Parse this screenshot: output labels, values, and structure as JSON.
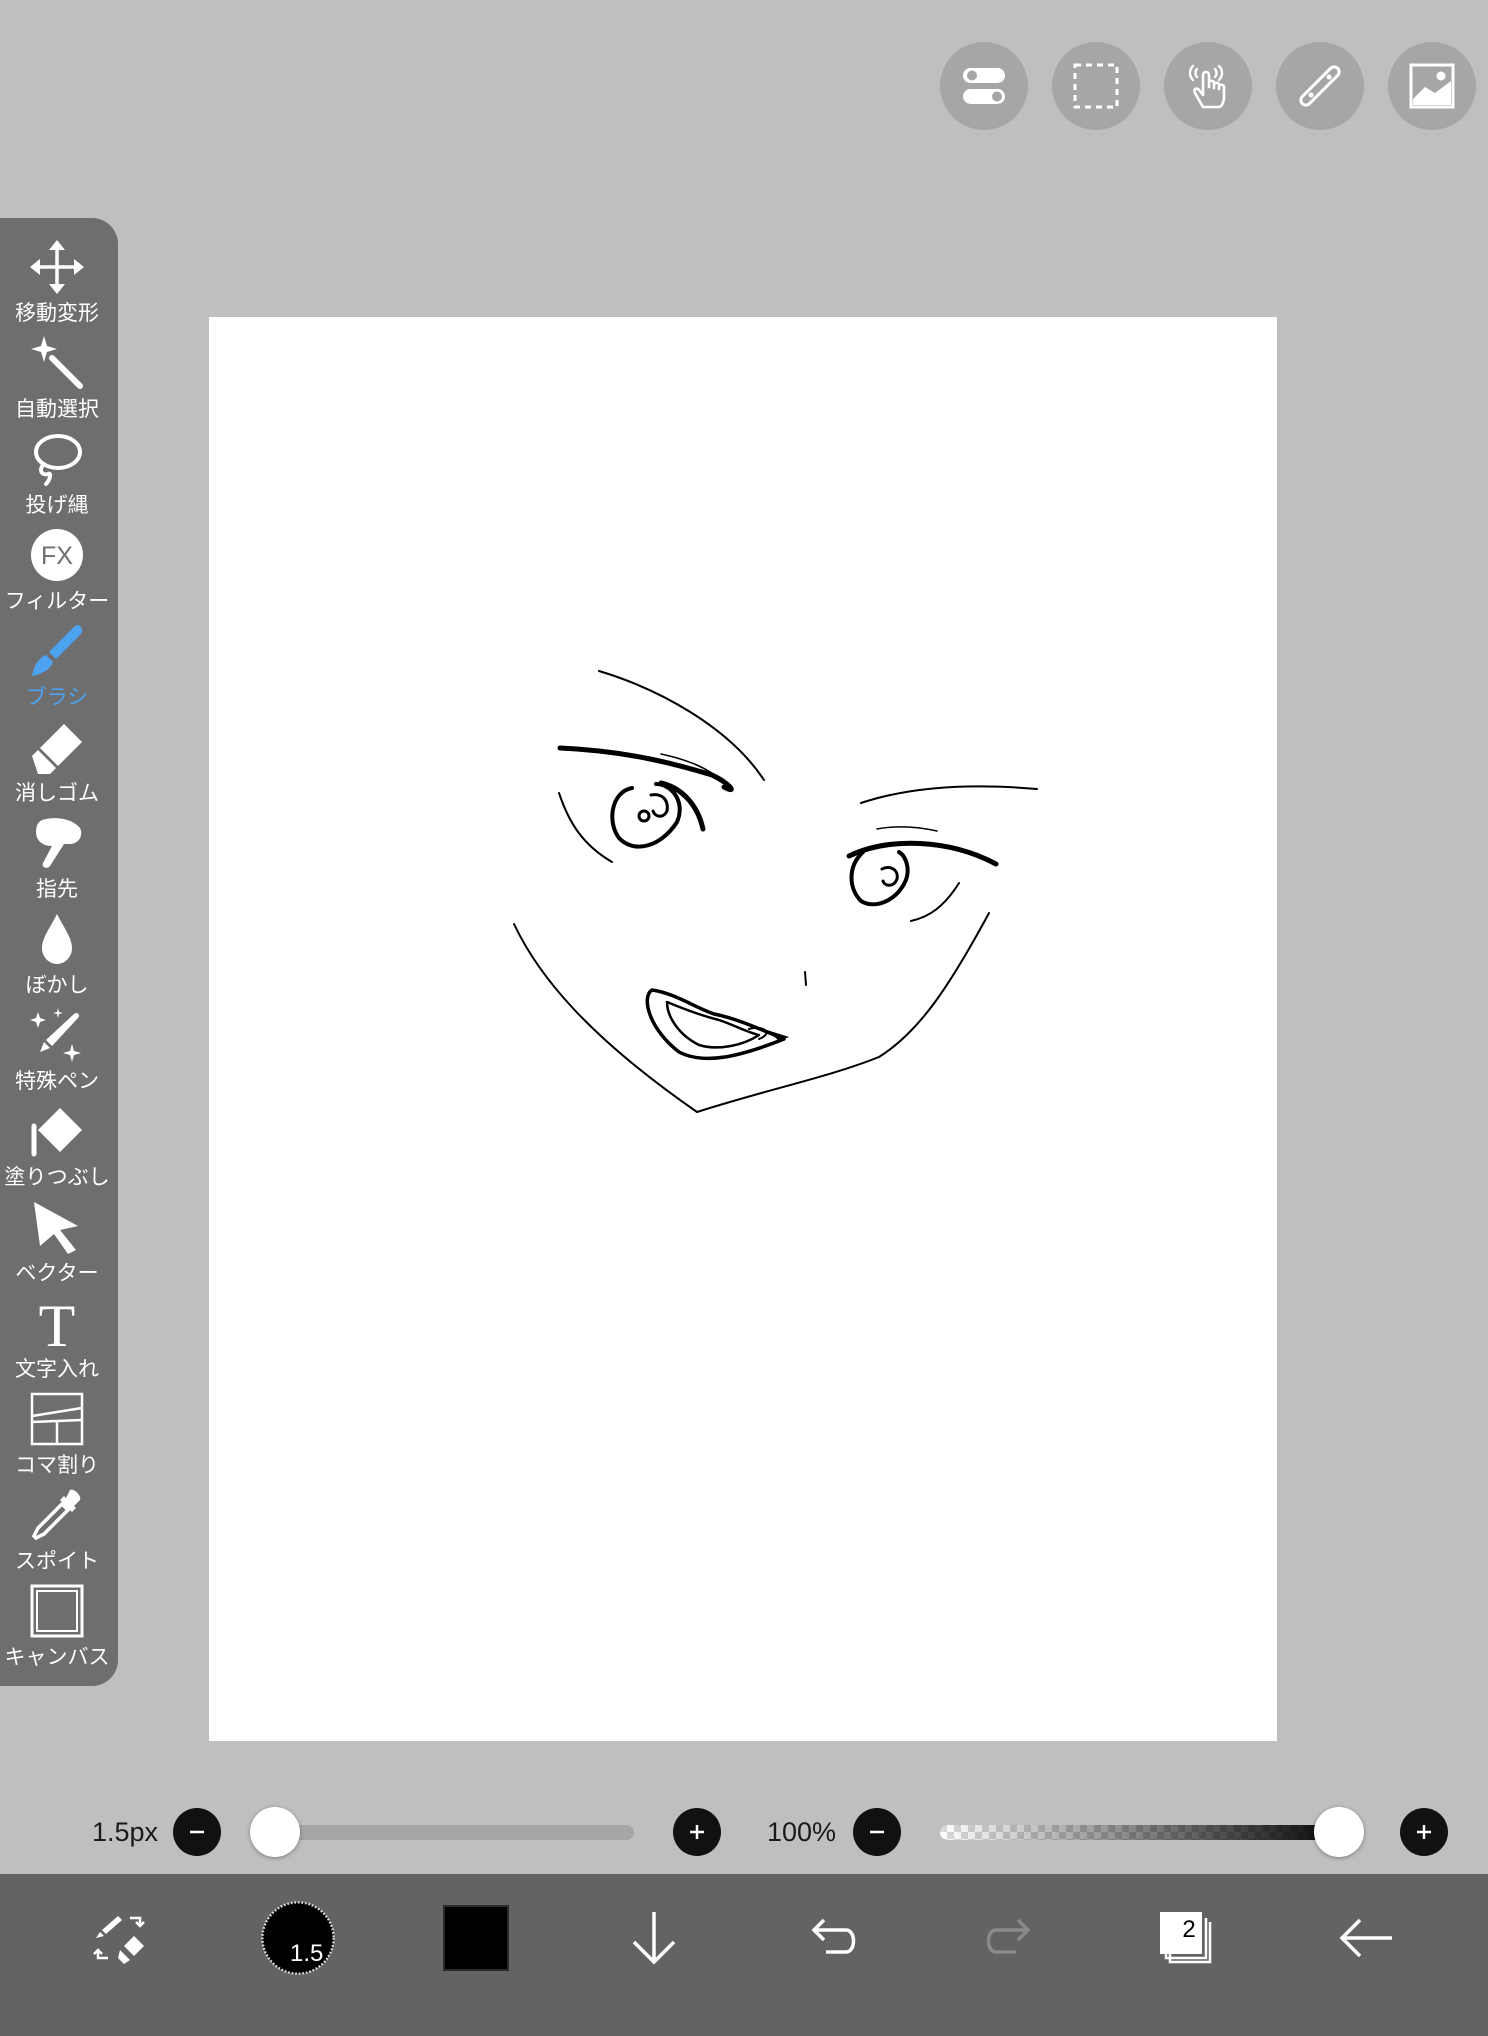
{
  "top_buttons": [
    {
      "name": "toggle-icon"
    },
    {
      "name": "selection-icon"
    },
    {
      "name": "touch-gesture-icon"
    },
    {
      "name": "ruler-icon"
    },
    {
      "name": "material-image-icon"
    }
  ],
  "toolbar": {
    "items": [
      {
        "label": "移動変形",
        "icon": "move-transform-icon"
      },
      {
        "label": "自動選択",
        "icon": "magic-wand-icon"
      },
      {
        "label": "投げ縄",
        "icon": "lasso-icon"
      },
      {
        "label": "フィルター",
        "icon": "fx-filter-icon"
      },
      {
        "label": "ブラシ",
        "icon": "brush-icon",
        "active": true
      },
      {
        "label": "消しゴム",
        "icon": "eraser-icon"
      },
      {
        "label": "指先",
        "icon": "finger-smudge-icon"
      },
      {
        "label": "ぼかし",
        "icon": "blur-drop-icon"
      },
      {
        "label": "特殊ペン",
        "icon": "special-pen-icon"
      },
      {
        "label": "塗りつぶし",
        "icon": "fill-bucket-icon"
      },
      {
        "label": "ベクター",
        "icon": "vector-cursor-icon"
      },
      {
        "label": "文字入れ",
        "icon": "text-icon"
      },
      {
        "label": "コマ割り",
        "icon": "panel-divide-icon"
      },
      {
        "label": "スポイト",
        "icon": "eyedropper-icon"
      },
      {
        "label": "キャンバス",
        "icon": "canvas-icon"
      }
    ],
    "active_color": "#4da3f0"
  },
  "brush": {
    "size_label": "1.5px",
    "size_value": 1.5,
    "size_slider_fraction": 0.0,
    "opacity_label": "100%",
    "opacity_slider_fraction": 1.0
  },
  "bottom_bar": {
    "brush_size_badge": "1.5",
    "current_color": "#000000",
    "layer_count": "2",
    "items": [
      {
        "name": "swap-pen-eraser-icon"
      },
      {
        "name": "brush-size-preview"
      },
      {
        "name": "color-swatch"
      },
      {
        "name": "download-arrow-icon"
      },
      {
        "name": "undo-icon"
      },
      {
        "name": "redo-icon"
      },
      {
        "name": "layers-icon"
      },
      {
        "name": "back-arrow-icon"
      }
    ]
  }
}
